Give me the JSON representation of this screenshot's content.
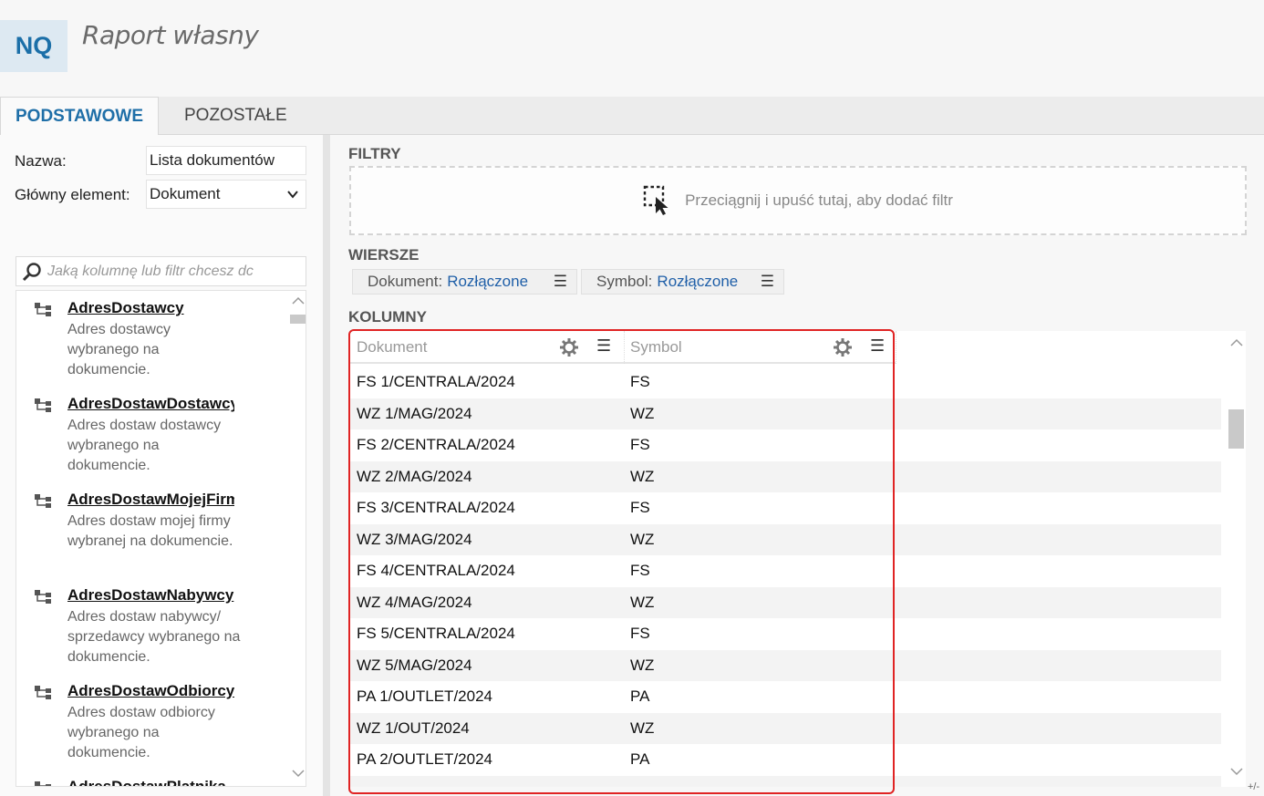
{
  "app": {
    "logo": "NQ",
    "title": "Raport własny"
  },
  "tabs": [
    {
      "label": "PODSTAWOWE",
      "active": true
    },
    {
      "label": "POZOSTAŁE",
      "active": false
    }
  ],
  "form": {
    "name_label": "Nazwa:",
    "name_value": "Lista dokumentów",
    "element_label": "Główny element:",
    "element_value": "Dokument"
  },
  "search": {
    "placeholder": "Jaką kolumnę lub filtr chcesz dc"
  },
  "fields": [
    {
      "name": "AdresDostawcy",
      "desc": "Adres dostawcy wybranego na dokumencie."
    },
    {
      "name": "AdresDostawDostawcy",
      "desc": "Adres dostaw dostawcy wybranego na dokumencie."
    },
    {
      "name": "AdresDostawMojejFirmy",
      "desc": "Adres dostaw mojej firmy wybranej na dokumencie."
    },
    {
      "name": "AdresDostawNabywcy",
      "desc": "Adres dostaw nabywcy/ sprzedawcy wybranego na dokumencie."
    },
    {
      "name": "AdresDostawOdbiorcy",
      "desc": "Adres dostaw odbiorcy wybranego na dokumencie."
    },
    {
      "name": "AdresDostawPlatnika",
      "desc": ""
    }
  ],
  "sections": {
    "filters": "FILTRY",
    "rows": "WIERSZE",
    "columns": "KOLUMNY"
  },
  "dropzone": {
    "text": "Przeciągnij i upuść tutaj, aby dodać filtr"
  },
  "row_chips": [
    {
      "field": "Dokument:",
      "mode": "Rozłączone"
    },
    {
      "field": "Symbol:",
      "mode": "Rozłączone"
    }
  ],
  "grid": {
    "columns": [
      "Dokument",
      "Symbol"
    ],
    "rows": [
      [
        "FS 1/CENTRALA/2024",
        "FS"
      ],
      [
        "WZ 1/MAG/2024",
        "WZ"
      ],
      [
        "FS 2/CENTRALA/2024",
        "FS"
      ],
      [
        "WZ 2/MAG/2024",
        "WZ"
      ],
      [
        "FS 3/CENTRALA/2024",
        "FS"
      ],
      [
        "WZ 3/MAG/2024",
        "WZ"
      ],
      [
        "FS 4/CENTRALA/2024",
        "FS"
      ],
      [
        "WZ 4/MAG/2024",
        "WZ"
      ],
      [
        "FS 5/CENTRALA/2024",
        "FS"
      ],
      [
        "WZ 5/MAG/2024",
        "WZ"
      ],
      [
        "PA 1/OUTLET/2024",
        "PA"
      ],
      [
        "WZ 1/OUT/2024",
        "WZ"
      ],
      [
        "PA 2/OUTLET/2024",
        "PA"
      ]
    ]
  },
  "corner_text": "+/-",
  "colors": {
    "accent": "#1f6fa8",
    "highlight": "#e02424",
    "link": "#1f5fa8"
  }
}
